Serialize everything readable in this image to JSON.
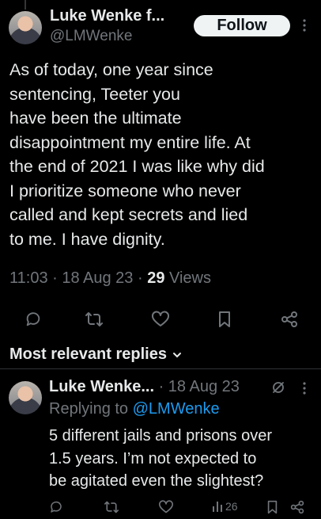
{
  "tweet": {
    "author_name": "Luke Wenke f...",
    "author_handle": "@LMWenke",
    "follow_label": "Follow",
    "text_lines": [
      "As of today, one year since",
      "sentencing, Teeter you",
      "have been the ultimate",
      "disappointment my entire life.  At",
      "the end of 2021 I was like why did",
      "I prioritize someone who never",
      "called and kept secrets and lied",
      "to me.  I have dignity."
    ],
    "time": "11:03 · 18 Aug 23 · ",
    "views_count": "29",
    "views_label": " Views"
  },
  "replies_header": {
    "label": "Most relevant replies"
  },
  "reply": {
    "author_name": "Luke Wenke...",
    "date": " · 18 Aug 23",
    "replying_prefix": "Replying to ",
    "replying_handle": "@LMWenke",
    "text_lines": [
      "5 different jails and prisons over",
      "1.5 years.  I’m not expected to",
      "be agitated even the slightest?"
    ],
    "views_count": "26"
  },
  "colors": {
    "background": "#000000",
    "text": "#e7e9ea",
    "muted": "#71767b",
    "accent": "#1d9bf0"
  },
  "icons": [
    "more-icon",
    "reply-icon",
    "retweet-icon",
    "like-icon",
    "bookmark-icon",
    "share-icon",
    "chevron-down-icon",
    "grok-icon",
    "views-icon"
  ]
}
